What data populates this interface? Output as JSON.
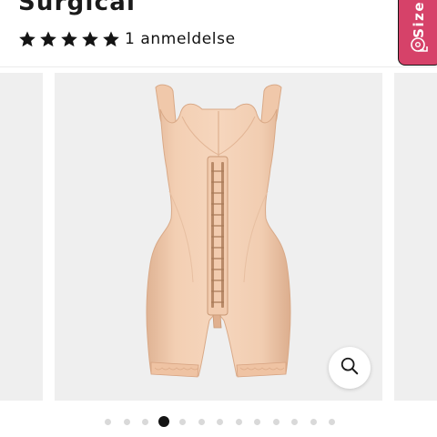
{
  "product": {
    "title": "Surgical",
    "rating": 5,
    "rating_max": 5,
    "review_count_label": "1 anmeldelse"
  },
  "size_tab": {
    "label": "Size",
    "icon": "measuring-tape-icon"
  },
  "gallery": {
    "image_alt": "Beige full body shapewear with hook front closure",
    "zoom_icon": "search-icon",
    "dot_count": 13,
    "active_dot_index": 3
  },
  "colors": {
    "accent": "#d64269",
    "text": "#1a1a1a",
    "slide_bg": "#efefef",
    "dot_inactive": "#d9d9d9",
    "dot_active": "#141414"
  }
}
